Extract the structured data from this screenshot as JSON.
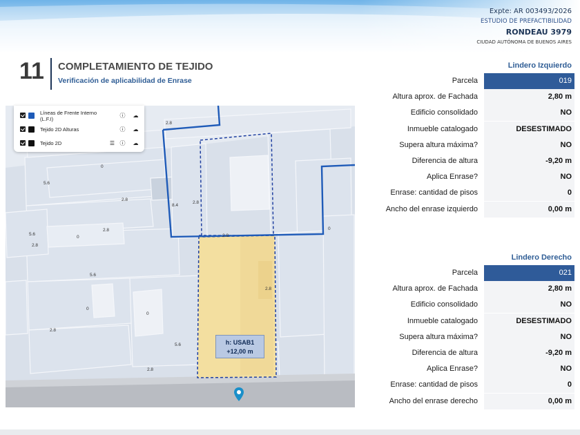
{
  "header": {
    "expediente": "Expte: AR 003493/2026",
    "study": "ESTUDIO DE PREFACTIBILIDAD",
    "address": "RONDEAU 3979",
    "city": "CIUDAD AUTÓNOMA DE BUENOS AIRES"
  },
  "section": {
    "number": "11",
    "title": "COMPLETAMIENTO DE TEJIDO",
    "subtitle": "Verificación de aplicabilidad de Enrase"
  },
  "map": {
    "legend": [
      {
        "label": "Líneas de Frente Interno (L.F.I)",
        "color": "#1e5bb8",
        "icons": [
          "info-icon",
          "cloud-icon"
        ]
      },
      {
        "label": "Tejido 2D Alturas",
        "color": "#111111",
        "icons": [
          "info-icon",
          "cloud-icon"
        ]
      },
      {
        "label": "Tejido 2D",
        "color": "#111111",
        "icons": [
          "list-icon",
          "info-icon",
          "cloud-icon"
        ]
      }
    ],
    "height_labels": [
      "2.8",
      "0",
      "5.6",
      "2.8",
      "8.4",
      "2.8",
      "2.8",
      "5.6",
      "0",
      "2.8",
      "2.8",
      "0",
      "5.6",
      "2.8",
      "0",
      "0",
      "2.8",
      "5.6",
      "2.8"
    ],
    "usab_line1": "h: USAB1",
    "usab_line2": "+12,00 m"
  },
  "lindero_izquierdo": {
    "title": "Lindero Izquierdo",
    "rows": [
      {
        "label": "Parcela",
        "value": "019"
      },
      {
        "label": "Altura aprox. de Fachada",
        "value": "2,80 m"
      },
      {
        "label": "Edificio consolidado",
        "value": "NO"
      },
      {
        "label": "Inmueble catalogado",
        "value": "DESESTIMADO"
      },
      {
        "label": "Supera altura máxima?",
        "value": "NO"
      },
      {
        "label": "Diferencia de altura",
        "value": "-9,20 m"
      },
      {
        "label": "Aplica Enrase?",
        "value": "NO"
      },
      {
        "label": "Enrase: cantidad de pisos",
        "value": "0"
      },
      {
        "label": "Ancho del enrase izquierdo",
        "value": "0,00 m"
      }
    ]
  },
  "lindero_derecho": {
    "title": "Lindero Derecho",
    "rows": [
      {
        "label": "Parcela",
        "value": "021"
      },
      {
        "label": "Altura aprox. de Fachada",
        "value": "2,80 m"
      },
      {
        "label": "Edificio consolidado",
        "value": "NO"
      },
      {
        "label": "Inmueble catalogado",
        "value": "DESESTIMADO"
      },
      {
        "label": "Supera altura máxima?",
        "value": "NO"
      },
      {
        "label": "Diferencia de altura",
        "value": "-9,20 m"
      },
      {
        "label": "Aplica Enrase?",
        "value": "NO"
      },
      {
        "label": "Enrase: cantidad de pisos",
        "value": "0"
      },
      {
        "label": "Ancho del enrase derecho",
        "value": "0,00 m"
      }
    ]
  }
}
